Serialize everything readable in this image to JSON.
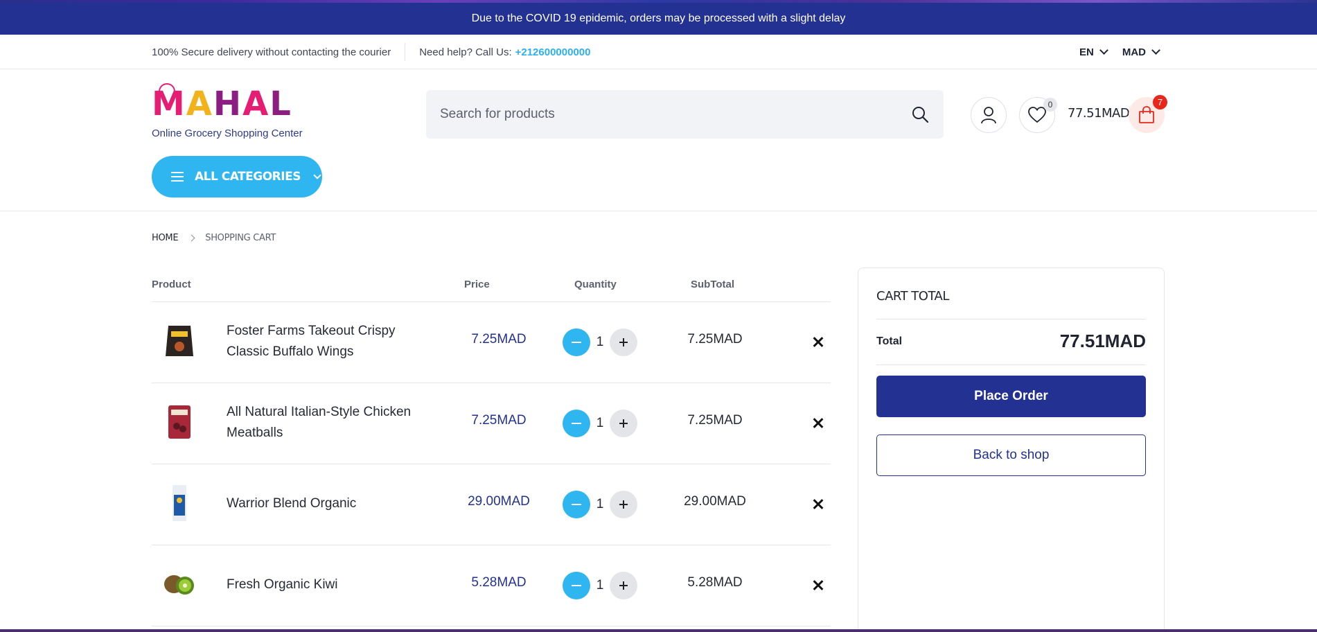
{
  "announcement": "Due to the COVID 19 epidemic, orders may be processed with a slight delay",
  "infobar": {
    "delivery_text": "100% Secure delivery without contacting the courier",
    "help_text": "Need help? Call Us:",
    "phone": "+212600000000",
    "language": "EN",
    "currency": "MAD"
  },
  "header": {
    "logo_letters": [
      "M",
      "A",
      "H",
      "A",
      "L"
    ],
    "logo_tagline": "Online Grocery Shopping Center",
    "categories_label": "ALL CATEGORIES",
    "search_placeholder": "Search for products",
    "wishlist_count": "0",
    "cart_total": "77.51MAD",
    "cart_count": "7"
  },
  "breadcrumb": {
    "home": "HOME",
    "current": "SHOPPING CART"
  },
  "table": {
    "headers": {
      "product": "Product",
      "price": "Price",
      "quantity": "Quantity",
      "subtotal": "SubTotal"
    },
    "rows": [
      {
        "name_line1": "Foster Farms Takeout Crispy",
        "name_line2": "Classic Buffalo Wings",
        "price": "7.25MAD",
        "qty": "1",
        "subtotal": "7.25MAD",
        "thumb_color": "#2b2420"
      },
      {
        "name_line1": "All Natural Italian-Style Chicken",
        "name_line2": "Meatballs",
        "price": "7.25MAD",
        "qty": "1",
        "subtotal": "7.25MAD",
        "thumb_color": "#a8283a"
      },
      {
        "name_line1": "Warrior Blend Organic",
        "name_line2": "",
        "price": "29.00MAD",
        "qty": "1",
        "subtotal": "29.00MAD",
        "thumb_color": "#1e5aa8"
      },
      {
        "name_line1": "Fresh Organic Kiwi",
        "name_line2": "",
        "price": "5.28MAD",
        "qty": "1",
        "subtotal": "5.28MAD",
        "thumb_color": "#7a5a2a"
      }
    ]
  },
  "cart_box": {
    "title": "CART TOTAL",
    "total_label": "Total",
    "total_value": "77.51MAD",
    "place_order": "Place Order",
    "back_to_shop": "Back to shop"
  },
  "colors": {
    "brand_navy": "#233192",
    "accent_blue": "#2fb5ef",
    "badge_red": "#e8271a"
  }
}
